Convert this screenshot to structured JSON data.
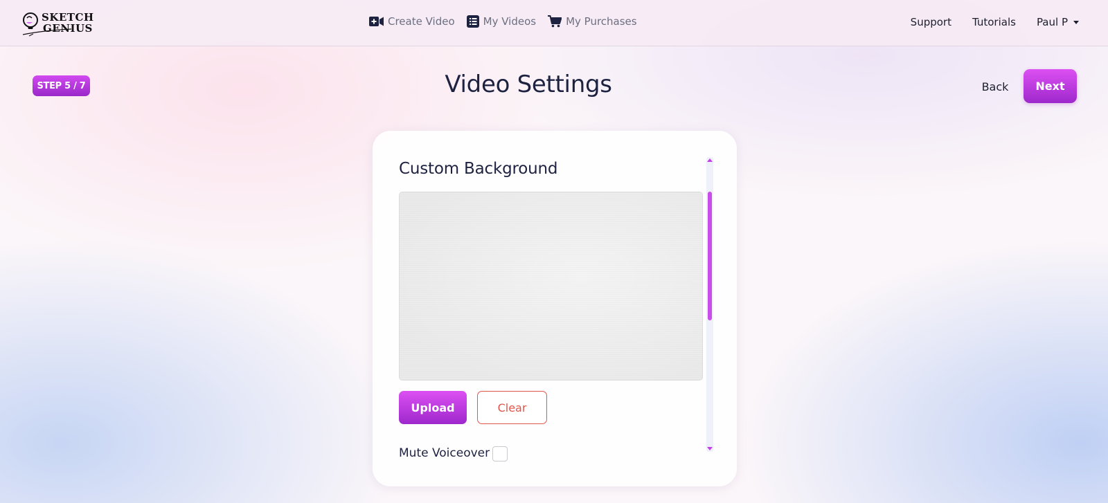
{
  "brand": {
    "logo_line1": "SKETCH",
    "logo_line2": "GENIUS"
  },
  "nav": {
    "center": [
      {
        "label": "Create Video",
        "icon": "video-camera-icon"
      },
      {
        "label": "My Videos",
        "icon": "list-icon"
      },
      {
        "label": "My Purchases",
        "icon": "cart-icon"
      }
    ],
    "right": {
      "support": "Support",
      "tutorials": "Tutorials",
      "user": "Paul P"
    }
  },
  "page": {
    "step_badge": "STEP 5 / 7",
    "title": "Video Settings",
    "back_label": "Back",
    "next_label": "Next"
  },
  "card": {
    "title": "Custom Background",
    "upload_label": "Upload",
    "clear_label": "Clear",
    "mute_label": "Mute Voiceover",
    "mute_checked": false
  },
  "colors": {
    "accent": "#c63eea",
    "accent_dark": "#9e28cc",
    "danger": "#e0564a",
    "text_dark": "#1d2240",
    "nav_muted": "#6c6f80"
  }
}
